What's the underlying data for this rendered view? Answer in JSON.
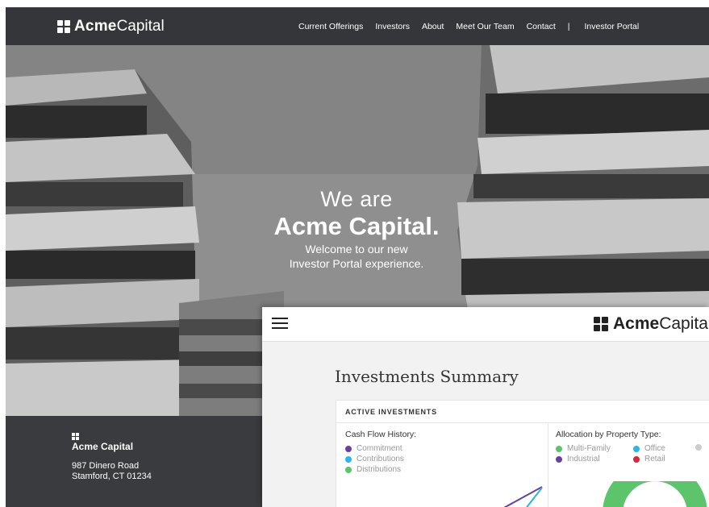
{
  "brand": {
    "bold": "Acme",
    "light": "Capital"
  },
  "nav": {
    "links": [
      "Current Offerings",
      "Investors",
      "About",
      "Meet Our Team",
      "Contact"
    ],
    "separator": "|",
    "portal_link": "Investor Portal"
  },
  "hero": {
    "line1": "We are",
    "line2": "Acme Capital.",
    "line3": "Welcome to our new",
    "line4": "Investor Portal experience."
  },
  "footer": {
    "company": "Acme Capital",
    "address_line1": "987 Dinero Road",
    "address_line2": "Stamford, CT 01234"
  },
  "portal": {
    "brand": {
      "bold": "Acme",
      "light": "Capita"
    },
    "page_title": "Investments Summary",
    "card_header": "ACTIVE INVESTMENTS",
    "cash_flow": {
      "title": "Cash Flow History:",
      "legend": [
        {
          "label": "Commitment",
          "color": "#6b3fa0"
        },
        {
          "label": "Contributions",
          "color": "#2bb5e8"
        },
        {
          "label": "Distributions",
          "color": "#5cc46a"
        }
      ]
    },
    "allocation": {
      "title": "Allocation by Property Type:",
      "legend": [
        {
          "label": "Multi-Family",
          "color": "#5cc46a"
        },
        {
          "label": "Office",
          "color": "#2bb5e8"
        },
        {
          "label": "",
          "color": "#cccccc"
        },
        {
          "label": "Industrial",
          "color": "#6b3fa0"
        },
        {
          "label": "Retail",
          "color": "#d42b3a"
        }
      ]
    }
  }
}
